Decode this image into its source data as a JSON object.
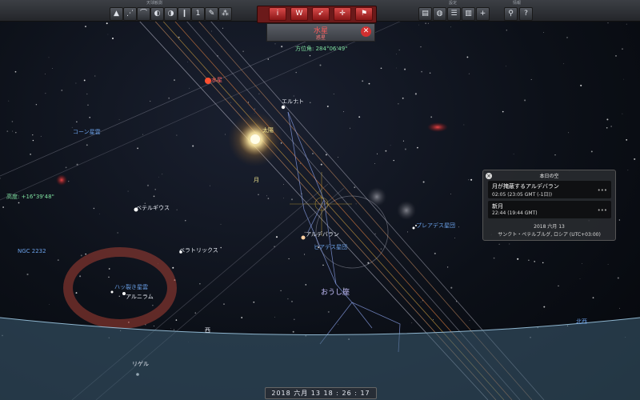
{
  "toolbar": {
    "sections": {
      "sky_view": "天球観測",
      "settings": "設定",
      "info": "情報"
    },
    "left_buttons": [
      {
        "name": "landscape-icon",
        "glyph": "▲"
      },
      {
        "name": "constellation-lines-icon",
        "glyph": "⋰"
      },
      {
        "name": "telescope-icon",
        "glyph": "⌒"
      },
      {
        "name": "satellite-icon",
        "glyph": "◐"
      },
      {
        "name": "planet-icon",
        "glyph": "◑"
      },
      {
        "name": "bottle-icon",
        "glyph": "❙"
      },
      {
        "name": "calendar-icon",
        "glyph": "1"
      },
      {
        "name": "pencil-icon",
        "glyph": "✎"
      },
      {
        "name": "deep-sky-icon",
        "glyph": "⁂"
      }
    ],
    "center_buttons": [
      {
        "name": "info-icon",
        "glyph": "i"
      },
      {
        "name": "wikipedia-icon",
        "glyph": "W"
      },
      {
        "name": "launch-icon",
        "glyph": "➶"
      },
      {
        "name": "crosshair-icon",
        "glyph": "✛"
      },
      {
        "name": "flag-icon",
        "glyph": "⚑"
      }
    ],
    "settings_buttons": [
      {
        "name": "layers-icon",
        "glyph": "▤"
      },
      {
        "name": "globe-icon",
        "glyph": "◍"
      },
      {
        "name": "sliders-icon",
        "glyph": "☰"
      },
      {
        "name": "list-icon",
        "glyph": "▥"
      },
      {
        "name": "add-panel-icon",
        "glyph": "+"
      }
    ],
    "info_buttons": [
      {
        "name": "search-icon",
        "glyph": "⚲"
      },
      {
        "name": "help-icon",
        "glyph": "?"
      }
    ]
  },
  "selected_object": {
    "name": "水星",
    "type": "惑星",
    "azimuth": "方位角: 284°06'49\""
  },
  "altitude": "高度: +16°39'48\"",
  "sky_labels": {
    "mercury": "水星",
    "sun": "太陽",
    "moon": "月",
    "elnath": "エルナト",
    "betelgeuse": "ベテルギウス",
    "bellatrix": "ベラトリックス",
    "aldebaran": "アルデバラン",
    "hyades": "ヒアデス星団",
    "pleiades": "プレアデス星団",
    "cone_nebula": "コーン星雲",
    "ngc2232": "NGC 2232",
    "sevenfold_nebula": "ハッ裂き星雲",
    "alnilam": "アルニラム",
    "rigel": "リゲル",
    "west": "西",
    "northwest": "北西",
    "taurus": "おうし座"
  },
  "tonight_panel": {
    "title": "本日の空",
    "events": [
      {
        "title": "月が掩蔽するアルデバラン",
        "time": "02:05 (23:05 GMT (-1日))"
      },
      {
        "title": "新月",
        "time": "22:44 (19:44 GMT)"
      }
    ],
    "date": "2018 六月 13",
    "location": "サンクト・ペテルブルグ, ロシア (UTC+03:00)"
  },
  "time_display": "2018  六月  13    18 : 26 : 17",
  "colors": {
    "accent_red": "#d23030",
    "label_blue": "#6aa0e8",
    "label_green": "#7fe0a0",
    "horizon": "#5e8aa8"
  }
}
